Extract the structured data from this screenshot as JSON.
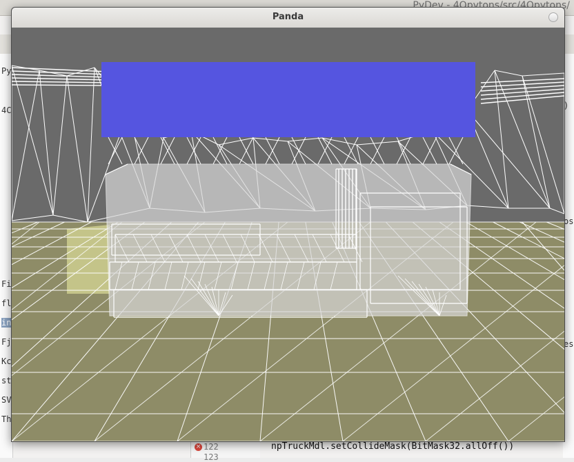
{
  "ide": {
    "title": "PyDev - 4Opytons/src/4Opytons/",
    "left_items": [
      "PyD",
      "4C",
      "Fi",
      "flo",
      "in",
      "Fjm",
      "Kc",
      "st",
      "SV",
      "Th"
    ],
    "right_items": [
      ")",
      "os",
      "es"
    ],
    "line_numbers": [
      "122",
      "123"
    ],
    "code_line": "npTruckMdl.setCollideMask(BitMask32.allOff())"
  },
  "window": {
    "title": "Panda"
  },
  "scene": {
    "background_color": "#6a6a6a",
    "ground_color": "#8e8c67",
    "wireframe_color": "#ffffff",
    "banner_color": "#5555e0",
    "box_color": "#d8d8d8",
    "collision_volume_color": "#e8e9a0"
  }
}
